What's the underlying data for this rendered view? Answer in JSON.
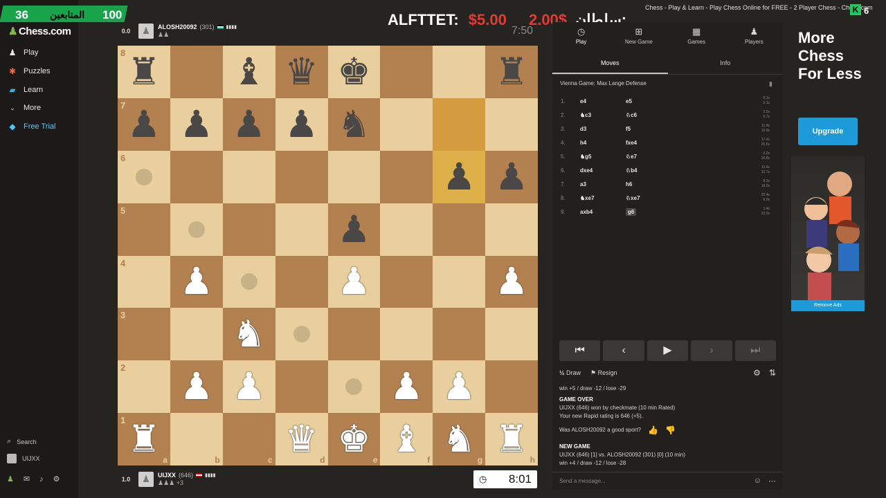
{
  "overlay": {
    "followers_count": "36",
    "followers_label": "المتابعين",
    "goal": "100",
    "donor_name": "ALFTTET:",
    "donation_amount": "$5.00",
    "donation_amount_alt": "2.00$",
    "donor_name_alt": "سلطان:",
    "browser_title": "Chess - Play & Learn - Play Chess Online for FREE - 2 Player Chess - Chess.com",
    "kick_badge": "K",
    "kick_count": "6"
  },
  "sidebar": {
    "logo": "Chess.com",
    "items": [
      {
        "label": "Play",
        "icon": "pawn-icon"
      },
      {
        "label": "Puzzles",
        "icon": "puzzle-icon"
      },
      {
        "label": "Learn",
        "icon": "learn-icon"
      },
      {
        "label": "More",
        "icon": "chevron-down-icon"
      },
      {
        "label": "Free Trial",
        "icon": "diamond-icon"
      }
    ],
    "search_label": "Search",
    "username": "UIJXX"
  },
  "top_player": {
    "score": "0.0",
    "name": "ALOSH20092",
    "rating": "(301)",
    "captured": "♟♟",
    "clock": "7:50"
  },
  "bottom_player": {
    "score": "1.0",
    "name": "UIJXX",
    "rating": "(646)",
    "captured": "♟♟♟ +3",
    "clock": "8:01"
  },
  "board": {
    "ranks": [
      "8",
      "7",
      "6",
      "5",
      "4",
      "3",
      "2",
      "1"
    ],
    "files": [
      "a",
      "b",
      "c",
      "d",
      "e",
      "f",
      "g",
      "h"
    ],
    "position": [
      [
        "br",
        "",
        "bb",
        "bq",
        "bk",
        "",
        "",
        "br"
      ],
      [
        "bp",
        "bp",
        "bp",
        "bp",
        "bn",
        "",
        "",
        ""
      ],
      [
        "",
        "",
        "",
        "",
        "",
        "",
        "bp",
        "bp"
      ],
      [
        "",
        "",
        "",
        "",
        "bp",
        "",
        "",
        ""
      ],
      [
        "",
        "wp",
        "",
        "",
        "wp",
        "",
        "",
        "wp"
      ],
      [
        "",
        "",
        "wn",
        "",
        "",
        "",
        "",
        ""
      ],
      [
        "",
        "wp",
        "wp",
        "",
        "",
        "wp",
        "wp",
        ""
      ],
      [
        "wr",
        "",
        "",
        "wq",
        "wk",
        "wb",
        "wn",
        "wr"
      ]
    ],
    "highlights": [
      "g7",
      "g6"
    ],
    "move_dots": [
      "a6",
      "b5",
      "c4",
      "d3",
      "e2"
    ]
  },
  "panel": {
    "tabs": [
      {
        "label": "Play",
        "icon": "clock-icon"
      },
      {
        "label": "New Game",
        "icon": "plus-icon"
      },
      {
        "label": "Games",
        "icon": "board-icon"
      },
      {
        "label": "Players",
        "icon": "players-icon"
      }
    ],
    "subtabs": [
      "Moves",
      "Info"
    ],
    "opening": "Vienna Game: Max Lange Defense",
    "moves": [
      {
        "n": "1.",
        "w": "e4",
        "b": "e5",
        "t1": "0.1s",
        "t2": "0.1s"
      },
      {
        "n": "2.",
        "w": "♞c3",
        "b": "♘c6",
        "t1": "2.5s",
        "t2": "5.7s"
      },
      {
        "n": "3.",
        "w": "d3",
        "b": "f5",
        "t1": "11.8s",
        "t2": "16.9s"
      },
      {
        "n": "4.",
        "w": "h4",
        "b": "fxe4",
        "t1": "17.4s",
        "t2": "25.5s"
      },
      {
        "n": "5.",
        "w": "♞g5",
        "b": "♘e7",
        "t1": "2.0s",
        "t2": "20.8s"
      },
      {
        "n": "6.",
        "w": "dxe4",
        "b": "♘b4",
        "t1": "13.4s",
        "t2": "12.7s"
      },
      {
        "n": "7.",
        "w": "a3",
        "b": "h6",
        "t1": "9.3s",
        "t2": "18.0s"
      },
      {
        "n": "8.",
        "w": "♞xe7",
        "b": "♘xe7",
        "t1": "25.4s",
        "t2": "6.9s"
      },
      {
        "n": "9.",
        "w": "axb4",
        "b": "g6",
        "t1": "1.4s",
        "t2": "23.3s"
      }
    ],
    "draw_label": "Draw",
    "resign_label": "Resign",
    "chat": {
      "line_prev": "win +5 / draw -12 / lose -29",
      "game_over_hdr": "GAME OVER",
      "result": "UIJXX (646) won by checkmate (10 min Rated)",
      "rating_msg": "Your new Rapid rating is 646 (+5).",
      "sport_question": "Was ALOSH20092 a good sport?",
      "new_game_hdr": "NEW GAME",
      "new_game_line": "UIJXX (646) [1] vs. ALOSH20092 (301) [0] (10 min)",
      "new_game_stakes": "win +4 / draw -12 / lose -28"
    },
    "message_placeholder": "Send a message..."
  },
  "ad": {
    "headline": "More Chess For Less",
    "upgrade": "Upgrade",
    "remove": "Remove Ads"
  }
}
